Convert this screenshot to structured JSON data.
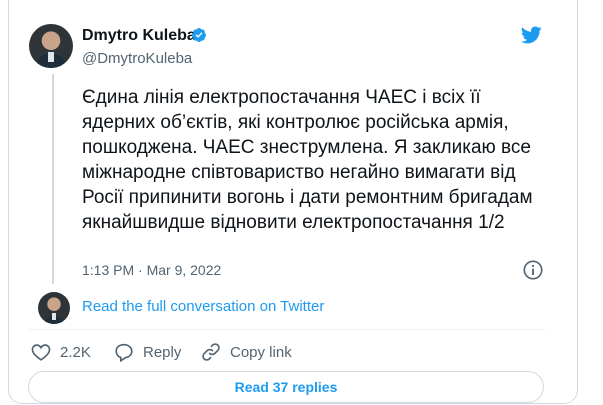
{
  "author": {
    "name": "Dmytro Kuleba",
    "handle": "@DmytroKuleba"
  },
  "tweet": {
    "text": "Єдина лінія електропостачання ЧАЕС і всіх її ядерних об’єктів, які контролює російська армія, пошкоджена. ЧАЕС знеструмлена. Я закликаю все міжнародне співтовариство негайно вимагати від Росії припинити вогонь і дати ремонтним бригадам якнайшвидше відновити електропостачання 1/2",
    "timestamp": "1:13 PM · Mar 9, 2022"
  },
  "conversation_link": "Read the full conversation on Twitter",
  "actions": {
    "like_count": "2.2K",
    "reply_label": "Reply",
    "copy_link_label": "Copy link"
  },
  "read_replies_label": "Read 37 replies",
  "icons": {
    "brand": "twitter-bird-icon",
    "verified": "verified-badge-icon",
    "info": "info-icon",
    "like": "heart-icon",
    "reply": "speech-bubble-icon",
    "copy": "link-icon"
  },
  "colors": {
    "accent": "#1d9bf0",
    "text": "#0f1419",
    "muted": "#536471",
    "border": "#cfd9de"
  }
}
